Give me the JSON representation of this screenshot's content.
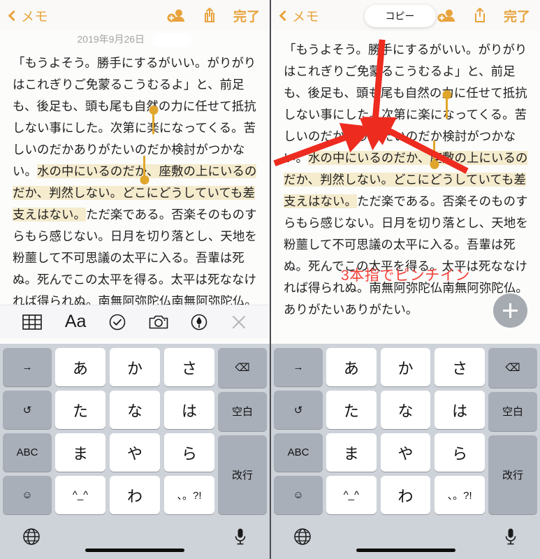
{
  "left": {
    "navbar": {
      "back_label": "メモ",
      "back_icon": "chevron-left-icon",
      "add_person_icon": "add-person-icon",
      "share_icon": "share-icon",
      "done_label": "完了"
    },
    "date": "2019年9月26日",
    "note_segments": [
      {
        "text": "「もうよそう。勝手にするがいい。がりがりはこれぎりご免蒙るこうむるよ」と、前足も、後足も、頭も尾も自然の力に任せて抵抗しない事にした。次第に楽になってくる。苦しいのだかありがたいのだか検討がつかない。",
        "highlighted": false
      },
      {
        "text": "水の中にいるのだか、座敷の上にいるのだか、判然しない。どこにどうしていても差支えはない。",
        "highlighted": true
      },
      {
        "text": "ただ楽である。否楽そのものすらもら感じない。日月を切り落とし、天地を粉蘁して不可思議の太平に入る。吾輩は死ぬ。死んでこの太平を得る。太平は死ななければ得られぬ。南無阿弥陀仏南無阿弥陀仏。ありがたいありがたい。",
        "highlighted": false
      }
    ],
    "toolbar": [
      {
        "name": "table-icon",
        "label": ""
      },
      {
        "name": "format-aa-icon",
        "label": "Aa"
      },
      {
        "name": "checklist-icon",
        "label": ""
      },
      {
        "name": "camera-icon",
        "label": ""
      },
      {
        "name": "markup-pen-icon",
        "label": ""
      },
      {
        "name": "close-icon",
        "label": ""
      }
    ]
  },
  "right": {
    "navbar": {
      "back_label": "メモ",
      "copy_label": "コピー",
      "done_label": "完了"
    },
    "note_segments": [
      {
        "text": "「もうよそう。勝手にするがいい。がりがりはこれぎりご免蒙るこうむるよ」と、前足も、後足も、頭も尾も自然の力に任せて抵抗しない事にした。次第に楽になってくる。苦しいのだかありがたいのだか検討がつかない。",
        "highlighted": false
      },
      {
        "text": "水の中にいるのだか、座敷の上にいるのだか、判然しない。どこにどうしていても差支えはない。",
        "highlighted": true
      },
      {
        "text": "ただ楽である。否楽そのものすらもら感じない。日月を切り落とし、天地を粉蘁して不可思議の太平に入る。吾輩は死ぬ。死んでこの太平を得る。太平は死ななければ得られぬ。南無阿弥陀仏南無阿弥陀仏。ありがたいありがたい。",
        "highlighted": false
      }
    ],
    "annotation": "3本指でピンチイン",
    "fab_icon": "plus-icon"
  },
  "keyboard": {
    "left_keys": [
      {
        "label": "→",
        "name": "key-arrow-right"
      },
      {
        "label": "↺",
        "name": "key-undo"
      },
      {
        "label": "ABC",
        "name": "key-abc"
      },
      {
        "label": "☺",
        "name": "key-emoji"
      }
    ],
    "center_keys": [
      {
        "label": "あ",
        "name": "key-a"
      },
      {
        "label": "か",
        "name": "key-ka"
      },
      {
        "label": "さ",
        "name": "key-sa"
      },
      {
        "label": "た",
        "name": "key-ta"
      },
      {
        "label": "な",
        "name": "key-na"
      },
      {
        "label": "は",
        "name": "key-ha"
      },
      {
        "label": "ま",
        "name": "key-ma"
      },
      {
        "label": "や",
        "name": "key-ya"
      },
      {
        "label": "ら",
        "name": "key-ra"
      },
      {
        "label": "^_^",
        "name": "key-kaomoji"
      },
      {
        "label": "わ",
        "name": "key-wa"
      },
      {
        "label": "、。?!",
        "name": "key-punctuation"
      }
    ],
    "right_keys": [
      {
        "label": "⌫",
        "name": "key-backspace"
      },
      {
        "label": "空白",
        "name": "key-space"
      },
      {
        "label": "改行",
        "name": "key-return"
      }
    ],
    "globe_icon": "globe-icon",
    "mic_icon": "microphone-icon"
  },
  "colors": {
    "accent": "#e8a33d",
    "highlight": "#f5ebcd",
    "annotation_red": "#f4423b",
    "keyboard_bg": "#ced2d9"
  }
}
